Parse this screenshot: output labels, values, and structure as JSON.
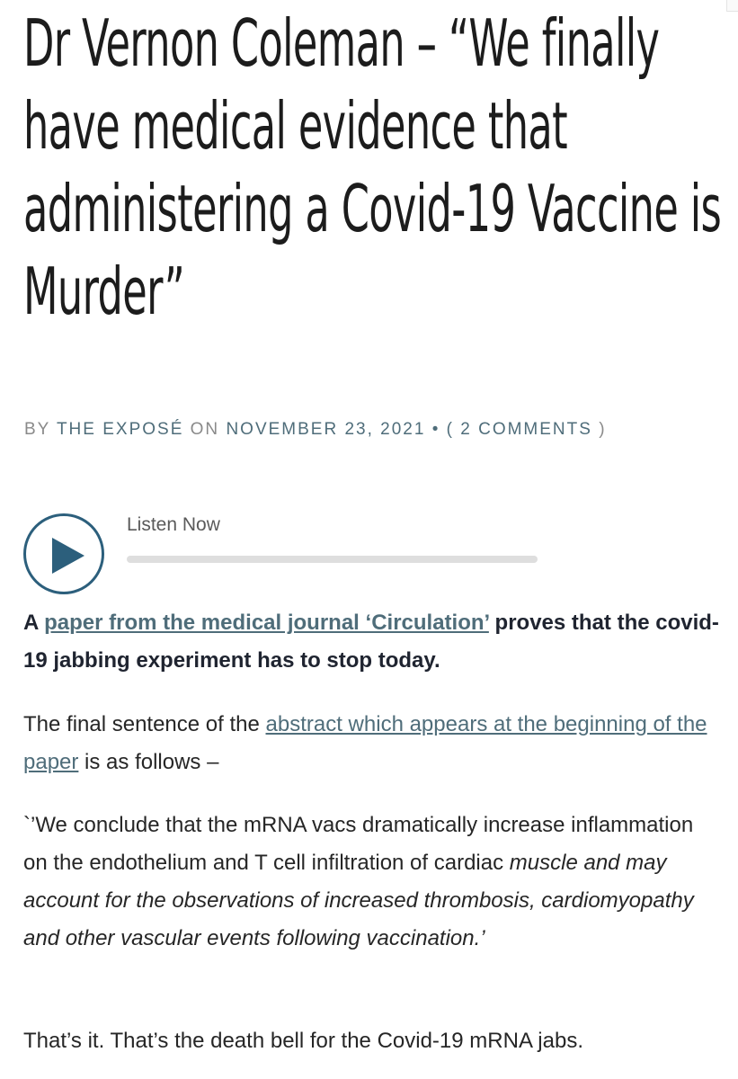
{
  "article": {
    "title": "Dr Vernon Coleman – “We finally have medical evidence that administering a Covid-19 Vaccine is Murder”",
    "byline": {
      "by": "BY",
      "author": "THE EXPOSÉ",
      "on": "ON",
      "date": "NOVEMBER 23, 2021",
      "bullet": "•",
      "open_paren": "(",
      "comments": "2 COMMENTS",
      "close_paren": ")"
    }
  },
  "player": {
    "label": "Listen Now",
    "progress": 0
  },
  "body": {
    "lead": {
      "prefix": "A ",
      "link": "paper from the medical journal ‘Circulation’",
      "suffix": " proves that the covid-19 jabbing experiment has to stop today."
    },
    "p2": {
      "prefix": "The final sentence of the ",
      "link": "abstract which appears at the beginning of the paper",
      "suffix": " is as follows –"
    },
    "p3": {
      "plain": "`’We conclude that the mRNA vacs dramatically increase inflammation on the endothelium and T cell infiltration of cardiac ",
      "italic": "muscle and may account for the observations of increased thrombosis, cardiomyopathy and other vascular events following vaccination.’"
    },
    "p4": "That’s it. That’s the death bell for the Covid-19 mRNA jabs."
  },
  "colors": {
    "accent": "#2c5f7c",
    "link": "#4f6d7a",
    "text": "#262626",
    "muted": "#8a8a8a"
  },
  "icons": {
    "play": "play-icon"
  }
}
